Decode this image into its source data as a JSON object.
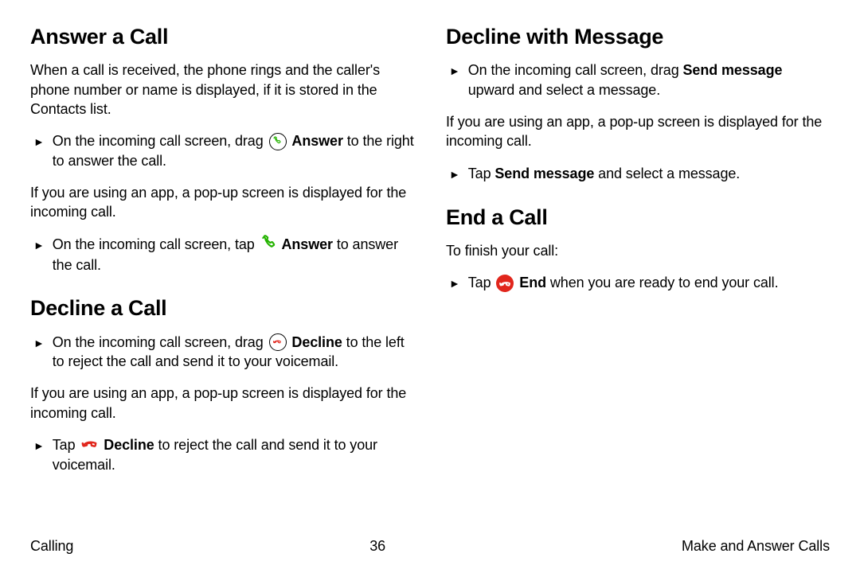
{
  "left": {
    "h_answer": "Answer a Call",
    "answer_intro": "When a call is received, the phone rings and the caller's phone number or name is displayed, if it is stored in the Contacts list.",
    "answer_step1_a": "On the incoming call screen, drag ",
    "answer_word": "Answer",
    "answer_step1_b": " to the right to answer the call.",
    "popup": "If you are using an app, a pop-up screen is displayed for the incoming call.",
    "answer_step2_a": "On the incoming call screen, tap ",
    "answer_step2_b": " to answer the call.",
    "h_decline": "Decline a Call",
    "decline_step1_a": "On the incoming call screen, drag ",
    "decline_word": "Decline",
    "decline_step1_b": " to the left to reject the call and send it to your voicemail.",
    "decline_step2_a": "Tap ",
    "decline_step2_b": " to reject the call and send it to your voicemail."
  },
  "right": {
    "h_declinemsg": "Decline with Message",
    "dm_step1_a": "On the incoming call screen, drag ",
    "send_msg": "Send message",
    "dm_step1_b": " upward and select a message.",
    "popup": "If you are using an app, a pop-up screen is displayed for the incoming call.",
    "dm_step2_a": "Tap ",
    "dm_step2_b": " and select a message.",
    "h_end": "End a Call",
    "end_intro": "To finish your call:",
    "end_step_a": "Tap ",
    "end_word": "End",
    "end_step_b": " when you are ready to end your call."
  },
  "footer": {
    "left": "Calling",
    "center": "36",
    "right": "Make and Answer Calls"
  }
}
